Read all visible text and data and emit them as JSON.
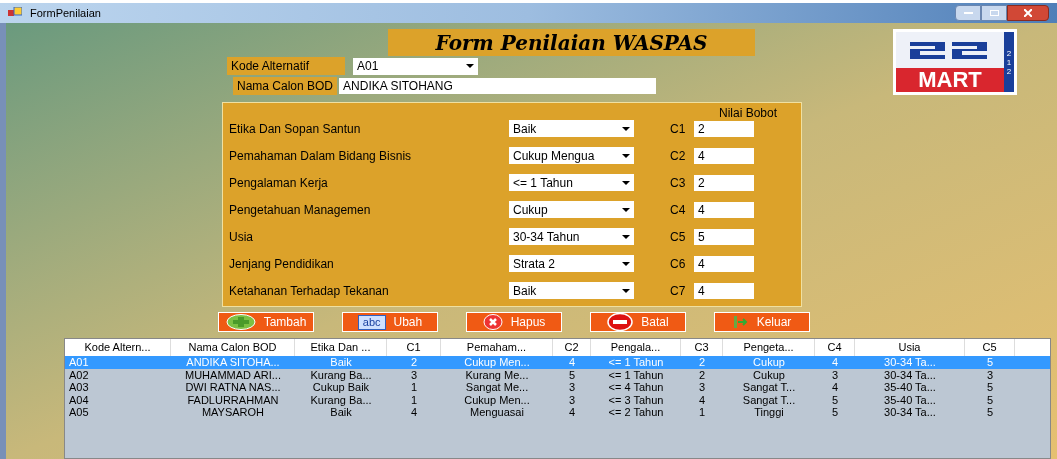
{
  "window": {
    "title": "FormPenilaian"
  },
  "title": "Form Penilaian WASPAS",
  "logo": {
    "top_text": "212",
    "brand": "MART"
  },
  "kode_alternatif": {
    "label": "Kode Alternatif",
    "value": "A01"
  },
  "nama_calon": {
    "label": "Nama Calon BOD",
    "value": "ANDIKA SITOHANG"
  },
  "criteria_panel": {
    "heading": "Nilai Bobot",
    "rows": [
      {
        "label": "Etika Dan Sopan Santun",
        "value": "Baik",
        "code": "C1",
        "weight": "2"
      },
      {
        "label": "Pemahaman Dalam Bidang Bisnis",
        "value": "Cukup Mengua",
        "code": "C2",
        "weight": "4"
      },
      {
        "label": "Pengalaman Kerja",
        "value": "<= 1 Tahun",
        "code": "C3",
        "weight": "2"
      },
      {
        "label": "Pengetahuan Managemen",
        "value": "Cukup",
        "code": "C4",
        "weight": "4"
      },
      {
        "label": "Usia",
        "value": "30-34 Tahun",
        "code": "C5",
        "weight": "5"
      },
      {
        "label": "Jenjang Pendidikan",
        "value": "Strata 2",
        "code": "C6",
        "weight": "4"
      },
      {
        "label": "Ketahanan Terhadap Tekanan",
        "value": "Baik",
        "code": "C7",
        "weight": "4"
      }
    ]
  },
  "buttons": [
    {
      "kind": "add",
      "label": "Tambah"
    },
    {
      "kind": "edit",
      "label": "Ubah",
      "icon_text": "abc"
    },
    {
      "kind": "delete",
      "label": "Hapus"
    },
    {
      "kind": "cancel",
      "label": "Batal"
    },
    {
      "kind": "exit",
      "label": "Keluar"
    }
  ],
  "table": {
    "columns": [
      "Kode Altern...",
      "Nama Calon BOD",
      "Etika Dan ...",
      "C1",
      "Pemaham...",
      "C2",
      "Pengala...",
      "C3",
      "Pengeta...",
      "C4",
      "Usia",
      "C5"
    ],
    "rows": [
      {
        "selected": true,
        "cells": [
          "A01",
          "ANDIKA SITOHA...",
          "Baik",
          "2",
          "Cukup Men...",
          "4",
          "<= 1 Tahun",
          "2",
          "Cukup",
          "4",
          "30-34 Ta...",
          "5"
        ]
      },
      {
        "selected": false,
        "cells": [
          "A02",
          "MUHAMMAD ARI...",
          "Kurang Ba...",
          "3",
          "Kurang Me...",
          "5",
          "<= 1 Tahun",
          "2",
          "Cukup",
          "3",
          "30-34 Ta...",
          "3"
        ]
      },
      {
        "selected": false,
        "cells": [
          "A03",
          "DWI RATNA NAS...",
          "Cukup Baik",
          "1",
          "Sangat Me...",
          "3",
          "<= 4 Tahun",
          "3",
          "Sangat T...",
          "4",
          "35-40 Ta...",
          "5"
        ]
      },
      {
        "selected": false,
        "cells": [
          "A04",
          "FADLURRAHMAN",
          "Kurang Ba...",
          "1",
          "Cukup Men...",
          "3",
          "<= 3 Tahun",
          "4",
          "Sangat T...",
          "5",
          "35-40 Ta...",
          "5"
        ]
      },
      {
        "selected": false,
        "cells": [
          "A05",
          "MAYSAROH",
          "Baik",
          "4",
          "Menguasai",
          "4",
          "<= 2 Tahun",
          "1",
          "Tinggi",
          "5",
          "30-34 Ta...",
          "5"
        ]
      }
    ]
  }
}
